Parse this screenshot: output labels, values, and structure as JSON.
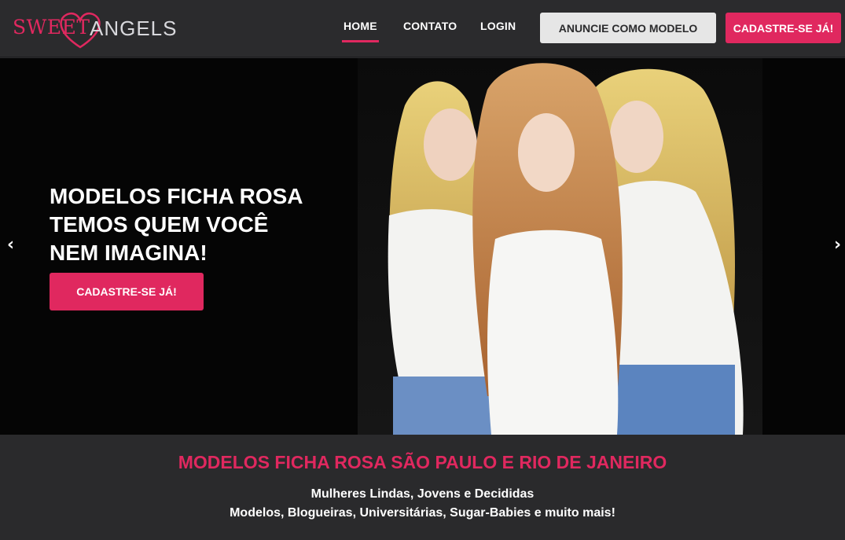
{
  "brand": {
    "logo_part1": "SWEET",
    "logo_part2": "ANGELS",
    "accent_color": "#e0285f",
    "header_bg": "#2b2b2d"
  },
  "nav": {
    "items": [
      {
        "label": "HOME",
        "active": true
      },
      {
        "label": "CONTATO",
        "active": false
      },
      {
        "label": "LOGIN",
        "active": false
      }
    ],
    "anuncie_label": "ANUNCIE COMO MODELO",
    "cadastre_label": "CADASTRE-SE JÁ!"
  },
  "hero": {
    "title_lines": [
      "MODELOS FICHA ROSA",
      "TEMOS QUEM VOCÊ",
      "NEM IMAGINA!"
    ],
    "cta_label": "CADASTRE-SE JÁ!",
    "prev_icon": "chevron-left-icon",
    "next_icon": "chevron-right-icon"
  },
  "section": {
    "heading": "MODELOS FICHA ROSA SÃO PAULO E RIO DE JANEIRO",
    "line1": "Mulheres Lindas, Jovens e Decididas",
    "line2": "Modelos, Blogueiras, Universitárias, Sugar-Babies e muito mais!"
  }
}
